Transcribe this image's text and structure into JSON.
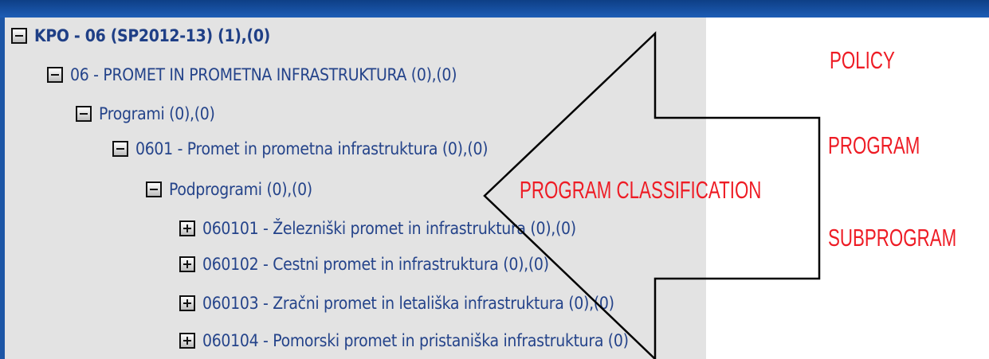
{
  "tree": {
    "nodes": [
      {
        "label": "KPO - 06 (SP2012-13) (1),(0)",
        "toggle": "collapse",
        "depth": 0
      },
      {
        "label": "06 - PROMET IN PROMETNA INFRASTRUKTURA (0),(0)",
        "toggle": "collapse",
        "depth": 1
      },
      {
        "label": "Programi (0),(0)",
        "toggle": "collapse",
        "depth": 2
      },
      {
        "label": "0601 - Promet in prometna infrastruktura (0),(0)",
        "toggle": "collapse",
        "depth": 3
      },
      {
        "label": "Podprogrami (0),(0)",
        "toggle": "collapse",
        "depth": 4
      },
      {
        "label": "060101 - Železniški promet in infrastruktura (0),(0)",
        "toggle": "expand",
        "depth": 5
      },
      {
        "label": "060102 - Cestni promet in infrastruktura (0),(0)",
        "toggle": "expand",
        "depth": 5
      },
      {
        "label": "060103 - Zračni promet in letališka infrastruktura (0),(0)",
        "toggle": "expand",
        "depth": 5
      },
      {
        "label": "060104 - Pomorski promet in pristaniška infrastruktura (0)",
        "toggle": "expand",
        "depth": 5
      }
    ]
  },
  "annotations": {
    "arrow_label": "PROGRAM CLASSIFICATION",
    "policy": "POLICY",
    "program": "PROGRAM",
    "subprogram": "SUBPROGRAM"
  },
  "colors": {
    "background": "#1f56a8",
    "tree_panel": "#e3e3e3",
    "link_text": "#24438a",
    "annotation_red": "#ee1c25"
  }
}
